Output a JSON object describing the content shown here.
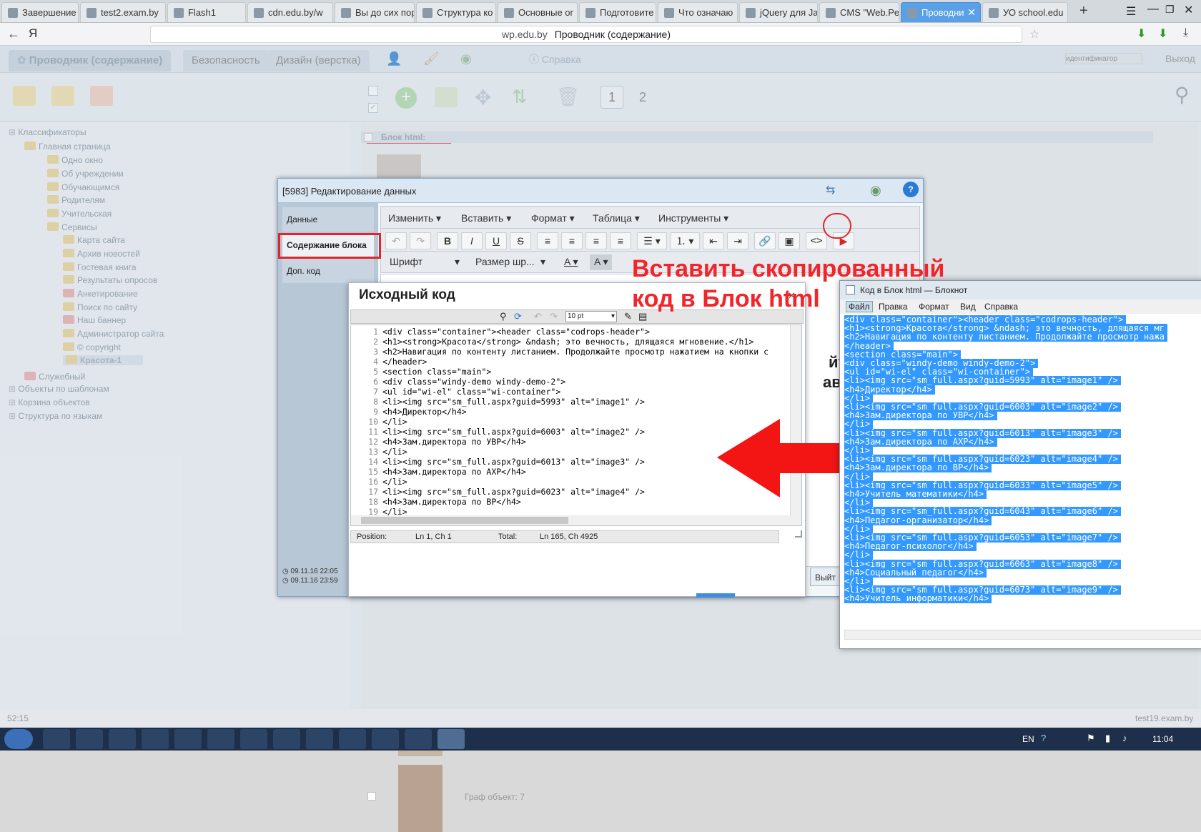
{
  "browser": {
    "tabs": [
      {
        "label": "Завершение"
      },
      {
        "label": "test2.exam.by"
      },
      {
        "label": "Flash1"
      },
      {
        "label": "cdn.edu.by/w"
      },
      {
        "label": "Вы до сих пор"
      },
      {
        "label": "Структура ко"
      },
      {
        "label": "Основные ог"
      },
      {
        "label": "Подготовите"
      },
      {
        "label": "Что означаю"
      },
      {
        "label": "jQuery для Ja"
      },
      {
        "label": "CMS \"Web.Pe"
      },
      {
        "label": "Проводни"
      },
      {
        "label": "УО school.edu"
      }
    ],
    "url_domain": "wp.edu.by",
    "url_title": "Проводник (содержание)"
  },
  "app": {
    "tabs": [
      "Проводник (содержание)",
      "Безопасность",
      "Дизайн (верстка)"
    ],
    "help": "Справка",
    "id_placeholder": "идентификатор",
    "logout": "Выход",
    "pages": [
      "1",
      "2"
    ],
    "block_label": "Блок html:",
    "graph_label": "Граф объект: 7"
  },
  "tree": [
    {
      "label": "Классификаторы",
      "level": 0
    },
    {
      "label": "Главная страница",
      "level": 1
    },
    {
      "label": "Одно окно",
      "level": 2
    },
    {
      "label": "Об учреждении",
      "level": 2
    },
    {
      "label": "Обучающимся",
      "level": 2
    },
    {
      "label": "Родителям",
      "level": 2
    },
    {
      "label": "Учительская",
      "level": 2
    },
    {
      "label": "Сервисы",
      "level": 2
    },
    {
      "label": "Карта сайта",
      "level": 3
    },
    {
      "label": "Архив новостей",
      "level": 3
    },
    {
      "label": "Гостевая книга",
      "level": 3
    },
    {
      "label": "Результаты опросов",
      "level": 3
    },
    {
      "label": "Анкетирование",
      "level": 3
    },
    {
      "label": "Поиск по сайту",
      "level": 3
    },
    {
      "label": "Наш баннер",
      "level": 3
    },
    {
      "label": "Администратор сайта",
      "level": 3
    },
    {
      "label": "© copyright",
      "level": 3
    },
    {
      "label": "Красота-1",
      "level": 3
    },
    {
      "label": "Служебный",
      "level": 1
    },
    {
      "label": "Объекты по шаблонам",
      "level": 0
    },
    {
      "label": "Корзина объектов",
      "level": 0
    },
    {
      "label": "Структура по языкам",
      "level": 0
    }
  ],
  "dialog": {
    "title": "[5983] Редактирование данных",
    "nav": [
      "Данные",
      "Содержание блока",
      "Доп. код"
    ],
    "menu": [
      "Изменить",
      "Вставить",
      "Формат",
      "Таблица",
      "Инструменты"
    ],
    "font": "Шрифт",
    "size": "Размер шр...",
    "dates": [
      "09.11.16 22:05",
      "09.11.16 23:59"
    ],
    "exit": "Выйт"
  },
  "source": {
    "title": "Исходный код",
    "fontsize": "10 pt",
    "lines": [
      "<div class=\"container\"><header class=\"codrops-header\">",
      "<h1><strong>Красота</strong> &ndash; это вечность, длящаяся мгновение.</h1>",
      "<h2>Навигация по контенту листанием. Продолжайте просмотр нажатием на кнопки с",
      "</header>",
      "<section class=\"main\">",
      "<div class=\"windy-demo windy-demo-2\">",
      "<ul id=\"wi-el\" class=\"wi-container\">",
      "<li><img src=\"sm_full.aspx?guid=5993\" alt=\"image1\" />",
      "<h4>Директор</h4>",
      "</li>",
      "<li><img src=\"sm_full.aspx?guid=6003\" alt=\"image2\" />",
      "<h4>Зам.директора по УВР</h4>",
      "</li>",
      "<li><img src=\"sm_full.aspx?guid=6013\" alt=\"image3\" />",
      "<h4>Зам.директора по АХР</h4>",
      "</li>",
      "<li><img src=\"sm_full.aspx?guid=6023\" alt=\"image4\" />",
      "<h4>Зам.директора по ВР</h4>",
      "</li>"
    ],
    "status_position_label": "Position:",
    "status_position": "Ln 1, Ch 1",
    "status_total_label": "Total:",
    "status_total": "Ln 165, Ch 4925"
  },
  "annotation": "Вставить скопированный код в Блок html",
  "notepad": {
    "title": "Код в Блок html — Блокнот",
    "menu": [
      "Файл",
      "Правка",
      "Формат",
      "Вид",
      "Справка"
    ],
    "lines": [
      "<div class=\"container\"><header class=\"codrops-header\">",
      "<h1><strong>Красота</strong> &ndash; это вечность, длящаяся мг",
      "<h2>Навигация по контенту листанием. Продолжайте просмотр нажа",
      "</header>",
      "<section class=\"main\">",
      "<div class=\"windy-demo windy-demo-2\">",
      "<ul id=\"wi-el\" class=\"wi-container\">",
      "<li><img src=\"sm_full.aspx?guid=5993\" alt=\"image1\" />",
      "<h4>Директор</h4>",
      "</li>",
      "<li><img src=\"sm_full.aspx?guid=6003\" alt=\"image2\" />",
      "<h4>Зам.директора по УВР</h4>",
      "</li>",
      "<li><img src=\"sm_full.aspx?guid=6013\" alt=\"image3\" />",
      "<h4>Зам.директора по АХР</h4>",
      "</li>",
      "<li><img src=\"sm_full.aspx?guid=6023\" alt=\"image4\" />",
      "<h4>Зам.директора по ВР</h4>",
      "</li>",
      "<li><img src=\"sm_full.aspx?guid=6033\" alt=\"image5\" />",
      "<h4>Учитель математики</h4>",
      "</li>",
      "<li><img src=\"sm_full.aspx?guid=6043\" alt=\"image6\" />",
      "<h4>Педагог-организатор</h4>",
      "</li>",
      "<li><img src=\"sm_full.aspx?guid=6053\" alt=\"image7\" />",
      "<h4>Педагог-психолог</h4>",
      "</li>",
      "<li><img src=\"sm_full.aspx?guid=6063\" alt=\"image8\" />",
      "<h4>Социальный педагог</h4>",
      "</li>",
      "<li><img src=\"sm_full.aspx?guid=6073\" alt=\"image9\" />",
      "<h4>Учитель информатики</h4>"
    ]
  },
  "status": {
    "left": "52:15",
    "right": "test19.exam.by"
  },
  "taskbar": {
    "lang": "EN",
    "time": "11:04"
  }
}
